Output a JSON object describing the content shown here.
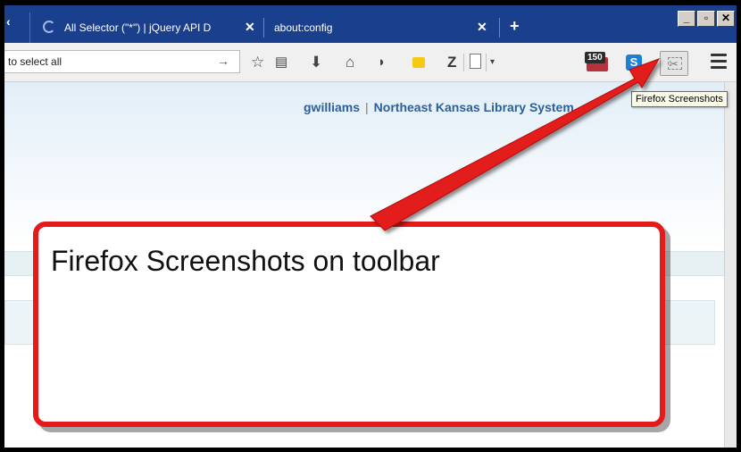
{
  "tabs": [
    {
      "title": "All Selector (\"*\") | jQuery API D",
      "close": "✕"
    },
    {
      "title": "about:config",
      "close": "✕"
    }
  ],
  "new_tab_label": "+",
  "window_buttons": {
    "minimize": "_",
    "maximize": "▫",
    "close": "✕"
  },
  "url_bar": {
    "value": "to select all",
    "go_arrow": "→"
  },
  "toolbar": {
    "icons": [
      "star-icon",
      "reading-list-icon",
      "download-icon",
      "home-icon",
      "pocket-icon",
      "sticky-note-icon",
      "zotero-icon",
      "document-icon",
      "dropdown-icon",
      "badge-extension-icon",
      "blue-extension-icon",
      "screenshot-icon",
      "menu-icon"
    ],
    "badge_count": "150",
    "zotero_label": "Z",
    "blue_ext_label": "S"
  },
  "tooltip": "Firefox Screenshots",
  "page": {
    "username": "gwilliams",
    "separator": "|",
    "library": "Northeast Kansas Library System"
  },
  "callout": {
    "text": "Firefox Screenshots on toolbar"
  },
  "colors": {
    "accent_red": "#e31b1b",
    "tab_bar": "#1a3f8c",
    "link_blue": "#2d5f98"
  }
}
